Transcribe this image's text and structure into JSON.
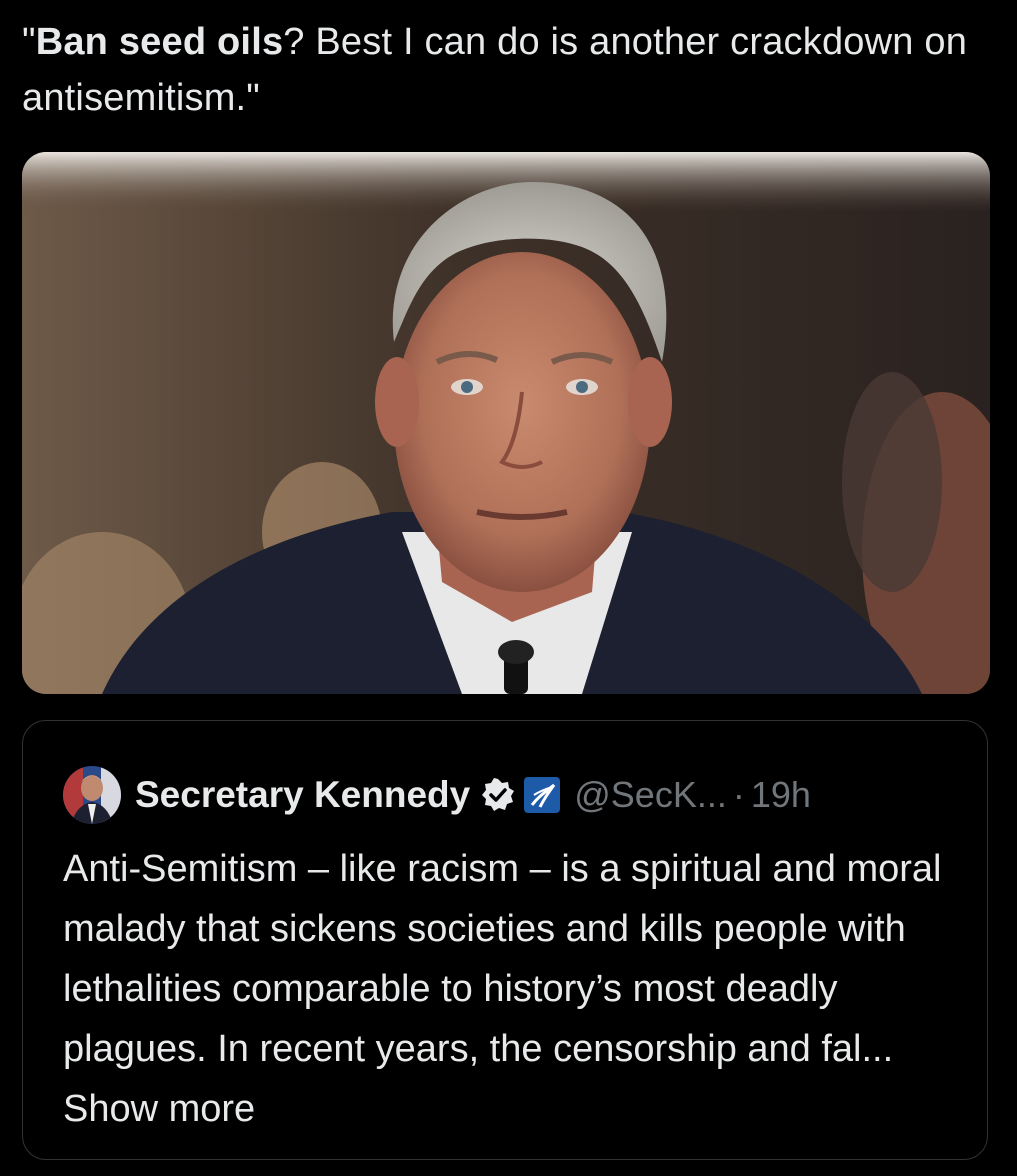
{
  "post": {
    "text_bold": "Ban seed oils",
    "text_pre": "\"",
    "text_rest": "? Best I can do is another crackdown on antisemitism.\""
  },
  "media": {
    "description_icon": "photo-of-man-at-hearing"
  },
  "quoted_post": {
    "author_name": "Secretary Kennedy",
    "handle": "@SecK...",
    "separator": "·",
    "time": "19h",
    "verified_badge_color": "#1d9bf0",
    "org_badge_color": "#1d5aa8",
    "body": "Anti-Semitism – like racism – is a spiritual and moral malady that sickens societies and kills people with lethalities comparable to history’s most deadly plagues. In recent years, the censorship and fal... ",
    "show_more": "Show more"
  },
  "colors": {
    "background": "#000000",
    "text": "#e7e9ea",
    "muted": "#71767b",
    "border": "#2f3336"
  }
}
